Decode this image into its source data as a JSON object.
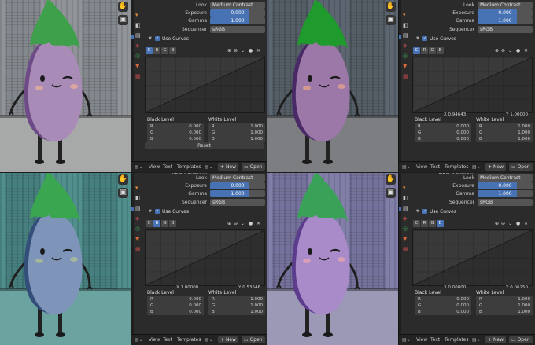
{
  "quadrants": [
    {
      "view_transform": "",
      "look": {
        "label": "Look",
        "value": "Medium Contrast"
      },
      "exposure": {
        "label": "Exposure",
        "value": "0.000"
      },
      "gamma": {
        "label": "Gamma",
        "value": "1.000"
      },
      "sequencer": {
        "label": "Sequencer",
        "value": "sRGB"
      },
      "use_curves": "Use Curves",
      "channels": [
        "C",
        "R",
        "G",
        "B"
      ],
      "active_channel": 0,
      "coord_x": "",
      "coord_y": "",
      "black_level": {
        "title": "Black Level",
        "rows": [
          {
            "k": "R",
            "v": "0.000"
          },
          {
            "k": "G",
            "v": "0.000"
          },
          {
            "k": "B",
            "v": "0.000"
          }
        ]
      },
      "white_level": {
        "title": "White Level",
        "rows": [
          {
            "k": "R",
            "v": "1.000"
          },
          {
            "k": "G",
            "v": "1.000"
          },
          {
            "k": "B",
            "v": "1.000"
          }
        ]
      },
      "reset": "Reset",
      "bottom": {
        "view": "View",
        "text": "Text",
        "templates": "Templates",
        "new": "New",
        "open": "Open"
      },
      "colors": {
        "wall": "#8b8f93",
        "door": "#7d8388",
        "floor": "#a7a9a9",
        "body": "#a98bb7",
        "body_dark": "#6e4a86",
        "leaf": "#3ea04a",
        "cheek": "#d9a7a0"
      }
    },
    {
      "view_transform": "",
      "look": {
        "label": "Look",
        "value": "Medium Contrast"
      },
      "exposure": {
        "label": "Exposure",
        "value": "0.000"
      },
      "gamma": {
        "label": "Gamma",
        "value": "1.000"
      },
      "sequencer": {
        "label": "Sequencer",
        "value": "sRGB"
      },
      "use_curves": "Use Curves",
      "channels": [
        "C",
        "R",
        "G",
        "B"
      ],
      "active_channel": 0,
      "coord_x": "X 0.94643",
      "coord_y": "Y 1.00000",
      "black_level": {
        "title": "Black Level",
        "rows": [
          {
            "k": "R",
            "v": "0.000"
          },
          {
            "k": "G",
            "v": "0.000"
          },
          {
            "k": "B",
            "v": "0.000"
          }
        ]
      },
      "white_level": {
        "title": "White Level",
        "rows": [
          {
            "k": "R",
            "v": "1.000"
          },
          {
            "k": "G",
            "v": "1.000"
          },
          {
            "k": "B",
            "v": "1.000"
          }
        ]
      },
      "reset": "",
      "bottom": {
        "view": "View",
        "text": "Text",
        "templates": "Templates",
        "new": "New",
        "open": "Open"
      },
      "colors": {
        "wall": "#56606a",
        "door": "#4e5860",
        "floor": "#7d7e82",
        "body": "#9c78a8",
        "body_dark": "#4a2a66",
        "leaf": "#1f9a2c",
        "cheek": "#d49a92"
      }
    },
    {
      "view_transform": "View Transform",
      "look": {
        "label": "Look",
        "value": "Medium Contrast"
      },
      "exposure": {
        "label": "Exposure",
        "value": "0.000"
      },
      "gamma": {
        "label": "Gamma",
        "value": "1.000"
      },
      "sequencer": {
        "label": "Sequencer",
        "value": "sRGB"
      },
      "use_curves": "Use Curves",
      "channels": [
        "C",
        "R",
        "G",
        "B"
      ],
      "active_channel": 1,
      "coord_x": "X 1.00000",
      "coord_y": "Y 0.53646",
      "black_level": {
        "title": "Black Level",
        "rows": [
          {
            "k": "R",
            "v": "0.000"
          },
          {
            "k": "G",
            "v": "0.000"
          },
          {
            "k": "B",
            "v": "0.000"
          }
        ]
      },
      "white_level": {
        "title": "White Level",
        "rows": [
          {
            "k": "R",
            "v": "1.000"
          },
          {
            "k": "G",
            "v": "1.000"
          },
          {
            "k": "B",
            "v": "1.000"
          }
        ]
      },
      "reset": "",
      "bottom": {
        "view": "View",
        "text": "Text",
        "templates": "Templates",
        "new": "New",
        "open": "Open"
      },
      "colors": {
        "wall": "#4a8a88",
        "door": "#3f7a79",
        "floor": "#6aa3a0",
        "body": "#7e94b8",
        "body_dark": "#344e7a",
        "leaf": "#3aa64f",
        "cheek": "#a3b59e"
      }
    },
    {
      "view_transform": "View Transform",
      "look": {
        "label": "Look",
        "value": "Medium Contrast"
      },
      "exposure": {
        "label": "Exposure",
        "value": "0.000"
      },
      "gamma": {
        "label": "Gamma",
        "value": "1.000"
      },
      "sequencer": {
        "label": "Sequencer",
        "value": "sRGB"
      },
      "use_curves": "Use Curves",
      "channels": [
        "C",
        "R",
        "G",
        "B"
      ],
      "active_channel": 3,
      "coord_x": "X 0.00000",
      "coord_y": "Y 0.06250",
      "black_level": {
        "title": "Black Level",
        "rows": [
          {
            "k": "R",
            "v": "0.000"
          },
          {
            "k": "G",
            "v": "0.000"
          },
          {
            "k": "B",
            "v": "0.000"
          }
        ]
      },
      "white_level": {
        "title": "White Level",
        "rows": [
          {
            "k": "R",
            "v": "1.000"
          },
          {
            "k": "G",
            "v": "1.000"
          },
          {
            "k": "B",
            "v": "1.000"
          }
        ]
      },
      "reset": "",
      "bottom": {
        "view": "View",
        "text": "Text",
        "templates": "Templates",
        "new": "New",
        "open": "Open"
      },
      "colors": {
        "wall": "#7c7aa3",
        "door": "#6f6c98",
        "floor": "#9b99b6",
        "body": "#a88bc8",
        "body_dark": "#5c3c8c",
        "leaf": "#3aa158",
        "cheek": "#d7a0b8"
      }
    }
  ]
}
